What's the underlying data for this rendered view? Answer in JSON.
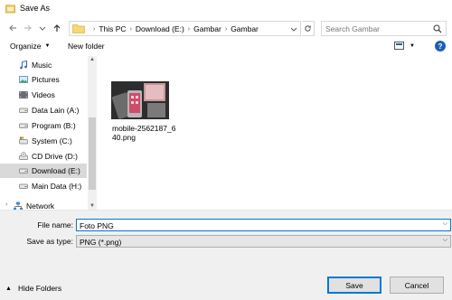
{
  "window": {
    "title": "Save As"
  },
  "address": {
    "crumbs": [
      "This PC",
      "Download (E:)",
      "Gambar",
      "Gambar"
    ],
    "search_placeholder": "Search Gambar"
  },
  "toolbar": {
    "organize": "Organize",
    "new_folder": "New folder"
  },
  "nav": {
    "items": [
      {
        "label": "Music",
        "icon": "music-icon"
      },
      {
        "label": "Pictures",
        "icon": "pictures-icon"
      },
      {
        "label": "Videos",
        "icon": "videos-icon"
      },
      {
        "label": "Data Lain (A:)",
        "icon": "drive-icon"
      },
      {
        "label": "Program (B:)",
        "icon": "drive-icon"
      },
      {
        "label": "System (C:)",
        "icon": "system-drive-icon"
      },
      {
        "label": "CD Drive (D:)",
        "icon": "cd-drive-icon"
      },
      {
        "label": "Download (E:)",
        "icon": "drive-icon",
        "selected": true
      },
      {
        "label": "Main Data (H:)",
        "icon": "drive-icon"
      },
      {
        "label": "Network",
        "icon": "network-icon"
      }
    ]
  },
  "files": [
    {
      "name": "mobile-2562187_640.png",
      "type": "image"
    }
  ],
  "form": {
    "file_name_label": "File name:",
    "file_name_value": "Foto PNG",
    "save_type_label": "Save as type:",
    "save_type_value": "PNG (*.png)"
  },
  "footer": {
    "hide_folders": "Hide Folders",
    "save": "Save",
    "cancel": "Cancel"
  },
  "colors": {
    "accent": "#0078d7",
    "selected_bg": "#d9d9d9",
    "panel_bg": "#f0f0f0",
    "help_blue": "#1e5fb4"
  }
}
